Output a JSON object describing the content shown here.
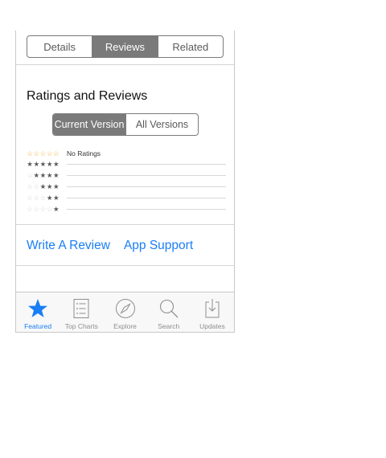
{
  "segments": {
    "details": "Details",
    "reviews": "Reviews",
    "related": "Related",
    "active": "reviews"
  },
  "ratings_section": {
    "title": "Ratings and Reviews",
    "version_toggle": {
      "current": "Current Version",
      "all": "All Versions",
      "active": "current"
    },
    "summary_stars": "☆☆☆☆☆",
    "summary_text": "No Ratings",
    "rows": [
      {
        "stars": 5,
        "count_fraction": 0
      },
      {
        "stars": 4,
        "count_fraction": 0
      },
      {
        "stars": 3,
        "count_fraction": 0
      },
      {
        "stars": 2,
        "count_fraction": 0
      },
      {
        "stars": 1,
        "count_fraction": 0
      }
    ]
  },
  "links": {
    "write_review": "Write A Review",
    "app_support": "App Support"
  },
  "tabbar": {
    "tabs": [
      {
        "label": "Featured",
        "icon": "star-icon",
        "active": true
      },
      {
        "label": "Top Charts",
        "icon": "list-icon",
        "active": false
      },
      {
        "label": "Explore",
        "icon": "compass-icon",
        "active": false
      },
      {
        "label": "Search",
        "icon": "search-icon",
        "active": false
      },
      {
        "label": "Updates",
        "icon": "download-tray-icon",
        "active": false
      }
    ]
  },
  "colors": {
    "accent": "#1a7ef5",
    "segment_active": "#7a7a7a",
    "star_orange": "#f5a623"
  }
}
